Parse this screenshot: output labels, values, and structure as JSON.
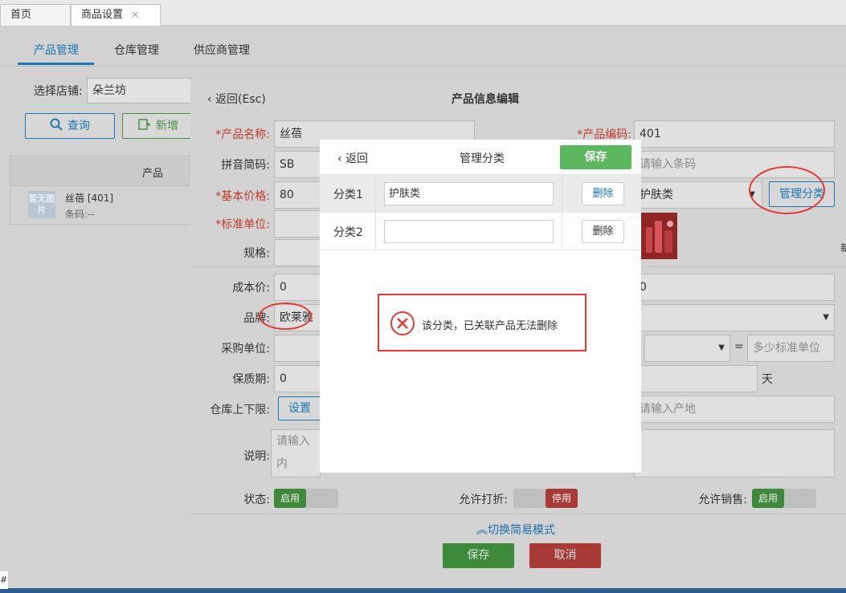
{
  "top_tabs": {
    "home": "首页",
    "settings": "商品设置",
    "close": "×"
  },
  "sub_tabs": [
    "产品管理",
    "仓库管理",
    "供应商管理"
  ],
  "store": {
    "label": "选择店铺:",
    "value": "朵兰坊"
  },
  "toolbar": {
    "query": "查询",
    "add": "新增"
  },
  "product_table": {
    "header": "产品",
    "rows": [
      {
        "thumb": "暂无图片",
        "name": "丝蓓 [401]",
        "barcode": "条码:--"
      }
    ]
  },
  "edit": {
    "back": "返回(Esc)",
    "title": "产品信息编辑",
    "name_label": "*产品名称:",
    "name_value": "丝蓓",
    "code_label": "*产品编码:",
    "code_value": "401",
    "pinyin_label": "拼音简码:",
    "pinyin_value": "SB",
    "barcode_placeholder": "请输入条码",
    "price_label": "*基本价格:",
    "price_value": "80",
    "category_value": "护肤类",
    "manage_category": "管理分类",
    "unit_label": "*标准单位:",
    "spec_label": "规格:",
    "cost_label": "成本价:",
    "cost_value": "0",
    "right_cost_value": "0",
    "brand_label": "品牌:",
    "brand_value": "欧莱雅",
    "purchase_unit_label": "采购单位:",
    "equals": "=",
    "std_qty_placeholder": "多少标准单位",
    "shelf_label": "保质期:",
    "shelf_value": "0",
    "day_unit": "天",
    "stock_label": "仓库上下限:",
    "stock_btn": "设置",
    "origin_placeholder": "请输入产地",
    "desc_label": "说明:",
    "desc_placeholder": "请输入内",
    "status_label": "状态:",
    "status_on": "启用",
    "discount_label": "允许打折:",
    "discount_off": "停用",
    "sale_label": "允许销售:",
    "sale_on": "启用",
    "switch_mode": "切换简易模式",
    "save": "保存",
    "cancel": "取消",
    "partial_char": "新"
  },
  "dialog": {
    "back": "返回",
    "title": "管理分类",
    "save": "保存",
    "rows": [
      {
        "label": "分类1",
        "value": "护肤类",
        "delete": "删除"
      },
      {
        "label": "分类2",
        "value": "",
        "delete": "删除"
      }
    ],
    "alert_message": "该分类，已关联产品无法删除"
  },
  "corner_mark": "#",
  "colors": {
    "primary_blue": "#1a78b5",
    "success_green": "#5cb85c",
    "danger_red": "#e53935"
  }
}
